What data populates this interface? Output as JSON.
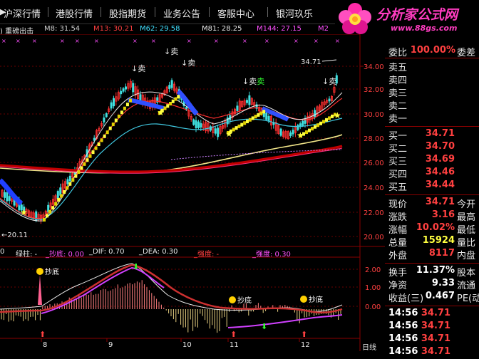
{
  "topbar": {
    "items": [
      "沪深行情",
      "港股行情",
      "股指期货",
      "业务公告",
      "客服中心",
      "银河玖乐"
    ]
  },
  "logo": {
    "name": "分析家公式网",
    "url": "www.88gs.com"
  },
  "ma_bar": {
    "title": "重磅出击",
    "m8": "M8: 31.54",
    "m13": "M13: 30.21",
    "m62": "M62: 29.58",
    "m81": "M81: 28.25",
    "m144": "M144: 27.15",
    "m2": "M2"
  },
  "price_axis": [
    "34.00",
    "32.00",
    "30.00",
    "28.00",
    "26.00",
    "24.00",
    "22.00",
    "20.00"
  ],
  "chart_labels": {
    "high": "34.71",
    "low": "20.11",
    "sell": "卖",
    "sell_green": "卖"
  },
  "macd_header": {
    "green_bar": "绿柱: -",
    "chaodi": "_抄底: 0.00",
    "dif": "_DIF: 0.70",
    "dea": "_DEA: 0.30",
    "strength1": "_强度: -",
    "strength2": "_强度: 0.30"
  },
  "macd_axis": [
    "2.00",
    "1.00",
    "0.00"
  ],
  "macd_labels": {
    "chaodi": "抄底"
  },
  "date_axis": [
    "8",
    "9",
    "10",
    "11",
    "12"
  ],
  "day_label": "日线",
  "panel": {
    "weibi_label": "委比",
    "weibi_value": "100.00%",
    "weicha_label": "委差",
    "sells": [
      "卖五",
      "卖四",
      "卖三",
      "卖二",
      "卖一"
    ],
    "buys": [
      {
        "label": "买一",
        "price": "34.71"
      },
      {
        "label": "买二",
        "price": "34.70"
      },
      {
        "label": "买三",
        "price": "34.69"
      },
      {
        "label": "买四",
        "price": "34.46"
      },
      {
        "label": "买五",
        "price": "34.44"
      }
    ],
    "stats": [
      {
        "label": "现价",
        "value": "34.71",
        "extra": "今开",
        "cls": "red"
      },
      {
        "label": "涨跌",
        "value": "3.16",
        "extra": "最高",
        "cls": "red"
      },
      {
        "label": "涨幅",
        "value": "10.02%",
        "extra": "最低",
        "cls": "red"
      },
      {
        "label": "总量",
        "value": "15924",
        "extra": "量比",
        "cls": "yellow"
      },
      {
        "label": "外盘",
        "value": "8117",
        "extra": "内盘",
        "cls": "red"
      }
    ],
    "stats2": [
      {
        "label": "换手",
        "value": "11.37%",
        "extra": "股本",
        "cls": "white"
      },
      {
        "label": "净资",
        "value": "9.33",
        "extra": "流通",
        "cls": "white"
      },
      {
        "label": "收益(三)",
        "value": "0.467",
        "extra": "PE(动",
        "cls": "white"
      }
    ],
    "ticks": [
      {
        "time": "14:56",
        "price": "34.71"
      },
      {
        "time": "14:56",
        "price": "34.71"
      },
      {
        "time": "14:56",
        "price": "34.71"
      },
      {
        "time": "14:56",
        "price": "34.71"
      }
    ]
  }
}
